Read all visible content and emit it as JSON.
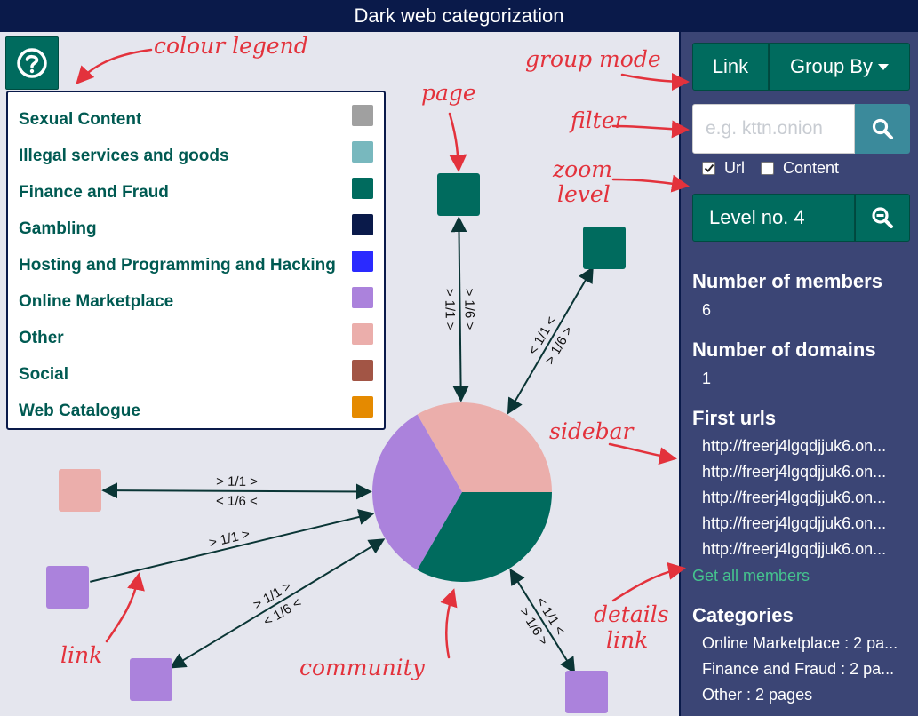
{
  "title": "Dark web categorization",
  "legend": [
    {
      "label": "Sexual Content",
      "color": "#a0a0a0"
    },
    {
      "label": "Illegal services and goods",
      "color": "#78b8be"
    },
    {
      "label": "Finance and Fraud",
      "color": "#006b5e"
    },
    {
      "label": "Gambling",
      "color": "#0a1a4a"
    },
    {
      "label": "Hosting and Programming and Hacking",
      "color": "#2a2aff"
    },
    {
      "label": "Online Marketplace",
      "color": "#ab82dc"
    },
    {
      "label": "Other",
      "color": "#ebaeab"
    },
    {
      "label": "Social",
      "color": "#a25545"
    },
    {
      "label": "Web Catalogue",
      "color": "#e58a00"
    }
  ],
  "toolbar": {
    "link_label": "Link",
    "groupby_label": "Group By",
    "search_placeholder": "e.g. kttn.onion",
    "url_label": "Url",
    "content_label": "Content",
    "url_checked": true,
    "content_checked": false,
    "level_label": "Level no. 4"
  },
  "sidebar": {
    "members_heading": "Number of members",
    "members_value": "6",
    "domains_heading": "Number of domains",
    "domains_value": "1",
    "urls_heading": "First urls",
    "urls": [
      "http://freerj4lgqdjjuk6.on...",
      "http://freerj4lgqdjjuk6.on...",
      "http://freerj4lgqdjjuk6.on...",
      "http://freerj4lgqdjjuk6.on...",
      "http://freerj4lgqdjjuk6.on..."
    ],
    "get_all_label": "Get all members",
    "categories_heading": "Categories",
    "categories": [
      "Online Marketplace : 2 pa...",
      "Finance and Fraud : 2 pa...",
      "Other : 2 pages"
    ]
  },
  "graph": {
    "community_slices": [
      {
        "category": "Other",
        "color": "#ebaeab",
        "fraction": 0.3333
      },
      {
        "category": "Online Marketplace",
        "color": "#ab82dc",
        "fraction": 0.3333
      },
      {
        "category": "Finance and Fraud",
        "color": "#006b5e",
        "fraction": 0.3334
      }
    ],
    "nodes": [
      {
        "name": "page-node-top",
        "color": "#006b5e"
      },
      {
        "name": "page-node-top-right",
        "color": "#006b5e"
      },
      {
        "name": "page-node-left-pink",
        "color": "#ebaeab"
      },
      {
        "name": "page-node-left-purple",
        "color": "#ab82dc"
      },
      {
        "name": "page-node-bottom-left",
        "color": "#ab82dc"
      },
      {
        "name": "page-node-bottom-right",
        "color": "#ab82dc"
      }
    ],
    "edge_labels": [
      {
        "outgoing": "> 1/6 >",
        "incoming": "> 1/1 >"
      },
      {
        "outgoing": "> 1/6 >",
        "incoming": "< 1/1 <"
      },
      {
        "outgoing": "> 1/1 >",
        "incoming": "< 1/6 <"
      },
      {
        "outgoing": "> 1/1 >",
        "incoming": ""
      },
      {
        "outgoing": "> 1/1 >",
        "incoming": "< 1/6 <"
      },
      {
        "outgoing": "> 1/6 >",
        "incoming": "< 1/1 <"
      }
    ]
  },
  "annotations": {
    "colour_legend": "colour legend",
    "group_mode": "group mode",
    "page": "page",
    "filter": "filter",
    "zoom_level_1": "zoom",
    "zoom_level_2": "level",
    "sidebar": "sidebar",
    "link": "link",
    "community": "community",
    "details_link_1": "details",
    "details_link_2": "link"
  }
}
